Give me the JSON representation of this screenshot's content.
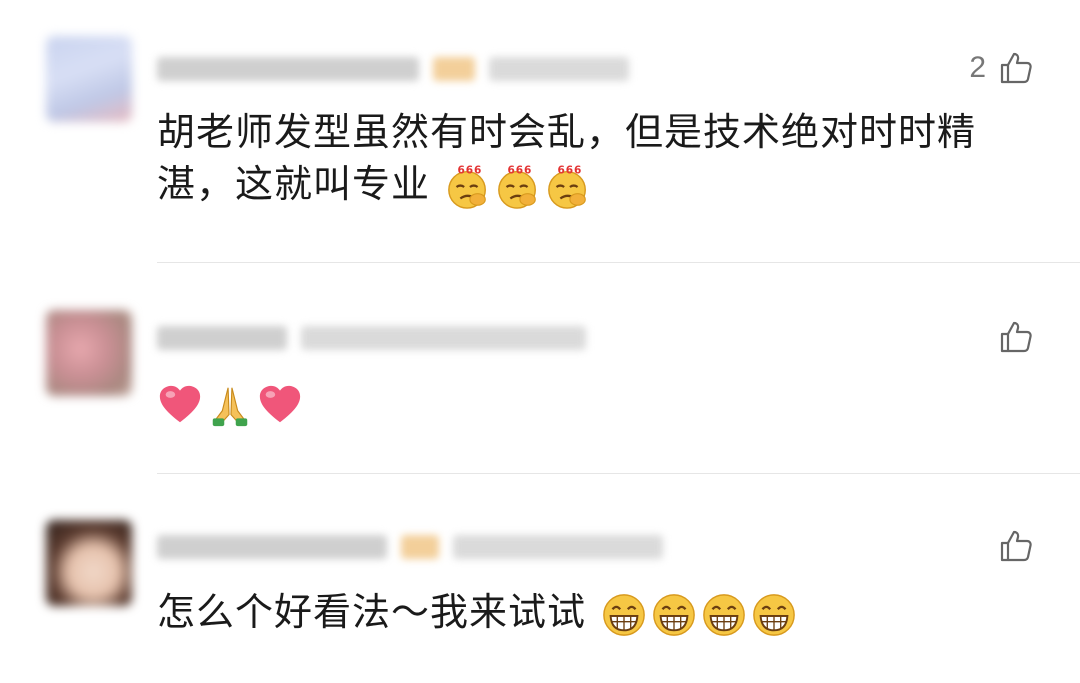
{
  "comments": [
    {
      "username": "",
      "timestamp": "",
      "like_count": "2",
      "text": "胡老师发型虽然有时会乱，但是技术绝对时时精湛，这就叫专业",
      "emojis": [
        "666-emoji",
        "666-emoji",
        "666-emoji"
      ]
    },
    {
      "username": "",
      "timestamp": "",
      "like_count": "",
      "text": "",
      "emojis": [
        "heart-emoji",
        "pray-emoji",
        "heart-emoji"
      ]
    },
    {
      "username": "",
      "timestamp": "",
      "like_count": "",
      "text": "怎么个好看法～我来试试",
      "emojis": [
        "grin-emoji",
        "grin-emoji",
        "grin-emoji",
        "grin-emoji"
      ]
    }
  ],
  "icons": {
    "like": "thumbs-up-icon",
    "666": "666-emoji",
    "heart": "heart-emoji",
    "pray": "pray-emoji",
    "grin": "grin-emoji"
  },
  "colors": {
    "text": "#1a1a1a",
    "meta": "#777777",
    "divider": "#e6e6e6"
  }
}
